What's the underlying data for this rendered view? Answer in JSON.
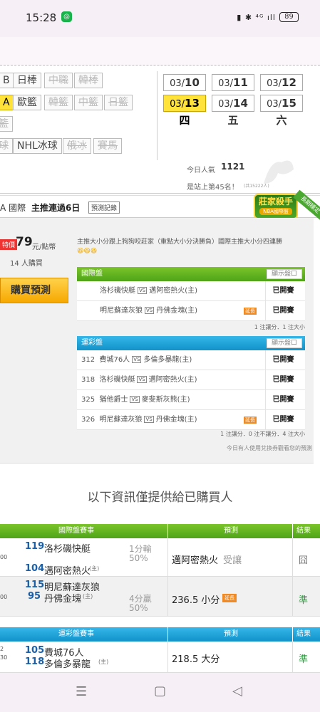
{
  "status": {
    "time": "15:28",
    "battery": "89",
    "icons": "▮ ✱ ⁴ᴳ ıll"
  },
  "nav": {
    "row1": [
      "B",
      "日棒",
      "中職",
      "韓棒"
    ],
    "row2": [
      "A",
      "歐籃",
      "韓籃",
      "中籃",
      "日籃"
    ],
    "row3": [
      "籃"
    ],
    "row4": [
      "球",
      "NHL冰球",
      "俄冰",
      "賽馬"
    ],
    "dates": [
      {
        "md": "03/",
        "d": "10",
        "w": "一"
      },
      {
        "md": "03/",
        "d": "11",
        "w": "二"
      },
      {
        "md": "03/",
        "d": "12",
        "w": "三"
      },
      {
        "md": "03/",
        "d": "13",
        "w": "四"
      },
      {
        "md": "03/",
        "d": "14",
        "w": "五"
      },
      {
        "md": "03/",
        "d": "15",
        "w": "六"
      }
    ],
    "popularity_label": "今日人氣",
    "popularity_value": "1121",
    "rank": "是站上第45名！",
    "rank_small": "(共15222人)"
  },
  "tip": {
    "title_prefix": "A 國際",
    "title_bold": "主推連過6日",
    "record_btn": "預測記錄",
    "badge_main": "莊家殺手",
    "badge_sub": "NBA國際盤",
    "ribbon": "長期穩定",
    "price_tag": "特價",
    "price": "79",
    "price_unit": "元/點幣",
    "buyers": "14 人購買",
    "buy_label": "購買預測",
    "desc": "主推大小分跟上狗狗咬莊家（重點大小分決勝負）國際主推大小分四連勝",
    "emoji": "😆😆😆",
    "intl_title": "國際盤",
    "show_odds": "顯示盤口",
    "intl_rows": [
      {
        "a": "洛杉磯快艇",
        "b": "邁阿密熱火(主)",
        "ot": "",
        "res": "已開賽"
      },
      {
        "a": "明尼蘇達灰狼",
        "b": "丹佛金塊(主)",
        "ot": "延長",
        "res": "已開賽"
      }
    ],
    "intl_summary": "1 注讓分．1 注大小",
    "lot_title": "運彩盤",
    "lot_rows": [
      {
        "n": "312",
        "a": "費城76人",
        "b": "多倫多暴龍(主)",
        "ot": "",
        "res": "已開賽"
      },
      {
        "n": "318",
        "a": "洛杉磯快艇",
        "b": "邁阿密熱火(主)",
        "ot": "",
        "res": "已開賽"
      },
      {
        "n": "325",
        "a": "猶他爵士",
        "b": "麥斐斯灰熊(主)",
        "ot": "",
        "res": "已開賽"
      },
      {
        "n": "326",
        "a": "明尼蘇達灰狼",
        "b": "丹佛金塊(主)",
        "ot": "延長",
        "res": "已開賽"
      }
    ],
    "lot_summary": "1 注讓分．0 注不讓分．4 注大小",
    "footnote": "今日有人使用兌換券觀看您的預測"
  },
  "info_text": "以下資訊僅提供給已購買人",
  "bottom": {
    "intl_header": "國際盤賽事",
    "pred_header": "預測",
    "result_header": "結果",
    "lot_header": "運彩盤賽事",
    "r1": {
      "t": "00",
      "n1": "119",
      "a": "洛杉磯快艇",
      "n2": "104",
      "b": "邁阿密熱火",
      "home": "(主)",
      "line1": "1分輸",
      "line2": "50%",
      "pred": "邁阿密熱火",
      "pred2": "受讓",
      "res": "囧"
    },
    "r2": {
      "t": "00",
      "n1": "115",
      "a": "明尼蘇達灰狼",
      "n2": "95",
      "b": "丹佛金塊",
      "home": "(主)",
      "line1": "4分贏",
      "line2": "50%",
      "pred": "236.5 小分",
      "ot": "延長",
      "res": "準"
    },
    "r3": {
      "t1": "2",
      "t2": "30",
      "n1": "105",
      "a": "費城76人",
      "n2": "118",
      "b": "多倫多暴龍",
      "home": "(主)",
      "pred": "218.5 大分",
      "res": "準"
    }
  },
  "navbar": {
    "menu": "☰",
    "home": "▢",
    "back": "◁"
  }
}
